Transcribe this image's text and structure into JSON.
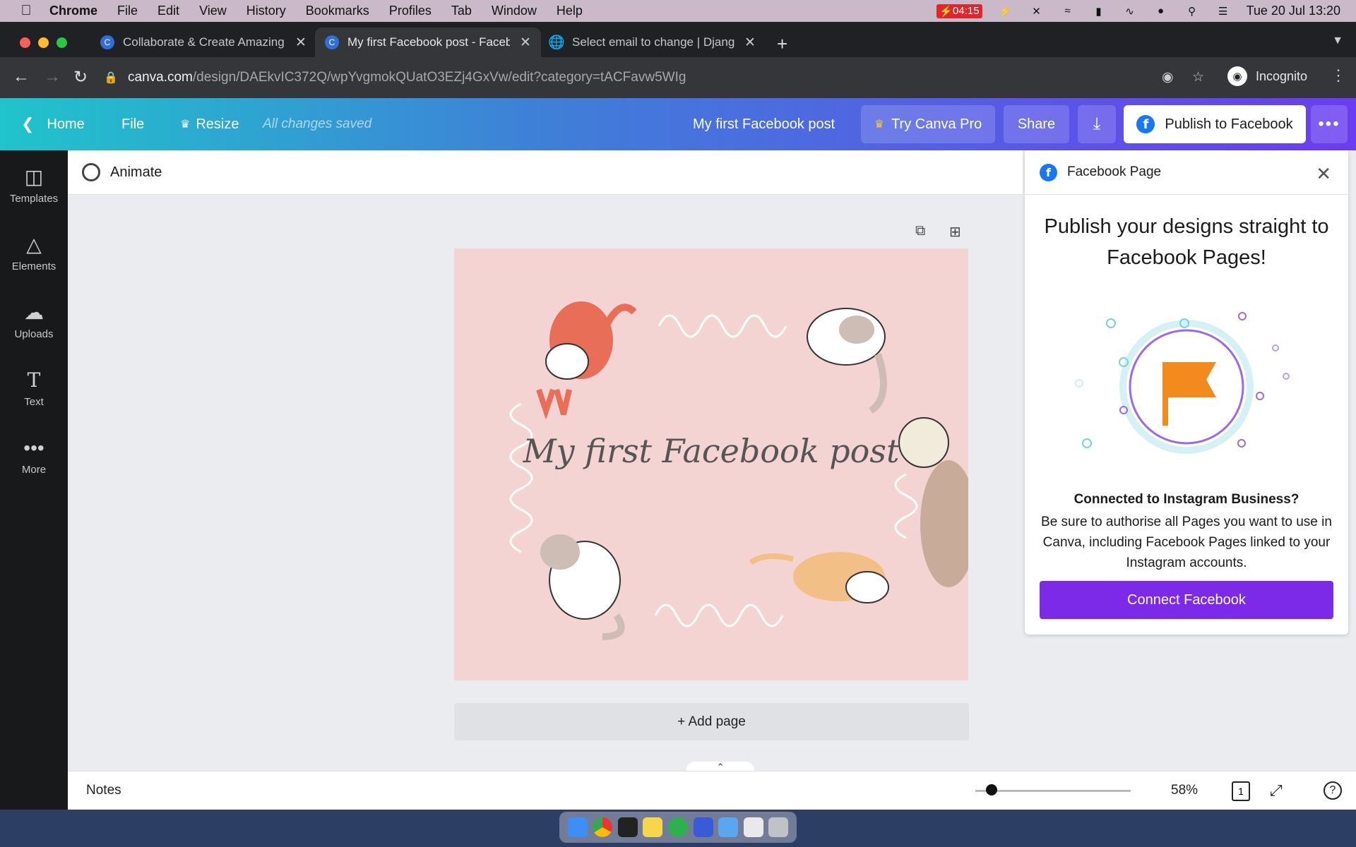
{
  "menubar": {
    "app": "Chrome",
    "items": [
      "File",
      "Edit",
      "View",
      "History",
      "Bookmarks",
      "Profiles",
      "Tab",
      "Window",
      "Help"
    ],
    "battery_time": "04:15",
    "datetime": "Tue 20 Jul  13:20"
  },
  "tabs": [
    {
      "title": "Collaborate & Create Amazing",
      "favicon": "C"
    },
    {
      "title": "My first Facebook post - Faceb",
      "favicon": "C"
    },
    {
      "title": "Select email to change | Djang",
      "favicon": "globe-icon"
    }
  ],
  "omnibox": {
    "host": "canva.com",
    "path": "/design/DAEkvIC372Q/wpYvgmokQUatO3EZj4GxVw/edit?category=tACFavw5WIg",
    "profile": "Incognito"
  },
  "canva_header": {
    "home": "Home",
    "file": "File",
    "resize": "Resize",
    "saved": "All changes saved",
    "design_title": "My first Facebook post",
    "try_pro": "Try Canva Pro",
    "share": "Share",
    "publish": "Publish to Facebook",
    "colors": {
      "gradient_start": "#20c4cb",
      "gradient_end": "#6a3df0"
    }
  },
  "sidebar": {
    "items": [
      {
        "label": "Templates",
        "icon": "templates-icon"
      },
      {
        "label": "Elements",
        "icon": "elements-icon"
      },
      {
        "label": "Uploads",
        "icon": "uploads-icon"
      },
      {
        "label": "Text",
        "icon": "text-icon"
      },
      {
        "label": "More",
        "icon": "more-icon"
      }
    ]
  },
  "toolbar": {
    "animate": "Animate"
  },
  "canvas": {
    "title": "My first Facebook post",
    "background": "#f4d4d2",
    "add_page": "+ Add page"
  },
  "fb_panel": {
    "title": "Facebook Page",
    "headline": "Publish your designs straight to Facebook Pages!",
    "question": "Connected to Instagram Business?",
    "description": "Be sure to authorise all Pages you want to use in Canva, including Facebook Pages linked to your Instagram accounts.",
    "button": "Connect Facebook",
    "button_color": "#7d2ae8"
  },
  "bottom": {
    "notes": "Notes",
    "zoom": "58%",
    "page_num": "1"
  }
}
